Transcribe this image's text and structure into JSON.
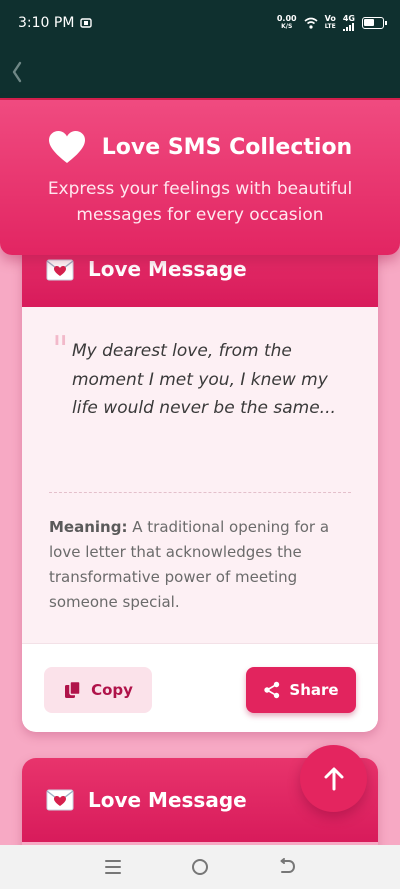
{
  "status_bar": {
    "time": "3:10 PM",
    "net_speed_value": "0.00",
    "net_speed_unit": "K/S",
    "volte_top": "Vo",
    "volte_bottom": "LTE",
    "network": "4G"
  },
  "header": {
    "title": "Love SMS Collection",
    "subtitle": "Express your feelings with beautiful messages for every occasion"
  },
  "cards": [
    {
      "title": "Love Message",
      "message": "My dearest love, from the moment I met you, I knew my life would never be the same...",
      "meaning_label": "Meaning:",
      "meaning_text": " A traditional opening for a love letter that acknowledges the transformative power of meeting someone special.",
      "copy_label": "Copy",
      "share_label": "Share"
    },
    {
      "title": "Love Message"
    }
  ],
  "colors": {
    "primary": "#e2245e",
    "app_bar": "#0f302f",
    "background": "#f7a9c4"
  }
}
